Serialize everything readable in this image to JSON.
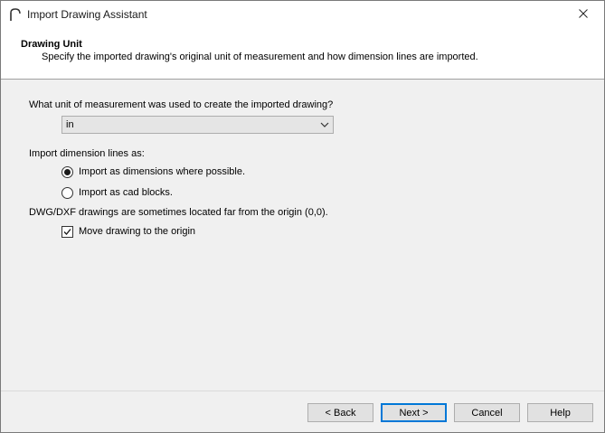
{
  "window": {
    "title": "Import Drawing Assistant",
    "app_icon": "chief-architect-arc-icon",
    "close_icon": "close-icon"
  },
  "header": {
    "title": "Drawing Unit",
    "subtitle": "Specify the imported drawing's original unit of measurement and how dimension lines are imported."
  },
  "unit": {
    "question": "What unit of measurement was used to create the imported drawing?",
    "selected": "in"
  },
  "dimension_lines": {
    "label": "Import dimension lines as:",
    "options": [
      {
        "label": "Import as dimensions where possible.",
        "checked": true
      },
      {
        "label": "Import as cad blocks.",
        "checked": false
      }
    ]
  },
  "origin": {
    "note": "DWG/DXF drawings are sometimes located far from the origin (0,0).",
    "checkbox_label": "Move drawing to the origin",
    "checked": true
  },
  "buttons": {
    "back": "< Back",
    "next": "Next >",
    "cancel": "Cancel",
    "help": "Help"
  },
  "colors": {
    "default_button_border": "#0078d7",
    "header_bg": "#ffffff",
    "body_bg": "#f0f0f0"
  }
}
